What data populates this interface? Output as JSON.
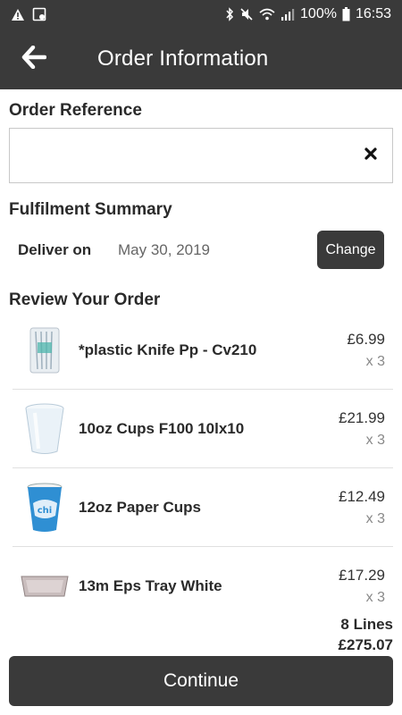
{
  "status_bar": {
    "battery": "100%",
    "time": "16:53",
    "icons": [
      "warning-icon",
      "image-icon",
      "bluetooth-icon",
      "mute-icon",
      "wifi-icon",
      "signal-icon",
      "battery-icon"
    ]
  },
  "app_bar": {
    "title": "Order Information",
    "back_icon": "arrow-left-icon"
  },
  "order_reference": {
    "heading": "Order Reference",
    "value": "",
    "clear_icon": "close-icon"
  },
  "fulfilment": {
    "heading": "Fulfilment Summary",
    "deliver_label": "Deliver on",
    "deliver_date": "May 30, 2019",
    "change_label": "Change"
  },
  "review": {
    "heading": "Review Your Order",
    "items": [
      {
        "name": "*plastic Knife Pp - Cv210",
        "price": "£6.99",
        "qty": "x 3",
        "icon": "plastic-knife-pack-image"
      },
      {
        "name": "10oz Cups F100 10lx10",
        "price": "£21.99",
        "qty": "x 3",
        "icon": "foam-cup-image"
      },
      {
        "name": "12oz Paper Cups",
        "price": "£12.49",
        "qty": "x 3",
        "icon": "paper-cup-image"
      },
      {
        "name": "13m Eps Tray White",
        "price": "£17.29",
        "qty": "x 3",
        "icon": "eps-tray-image"
      }
    ]
  },
  "summary": {
    "lines": "8 Lines",
    "total": "£275.07"
  },
  "footer": {
    "continue_label": "Continue"
  }
}
